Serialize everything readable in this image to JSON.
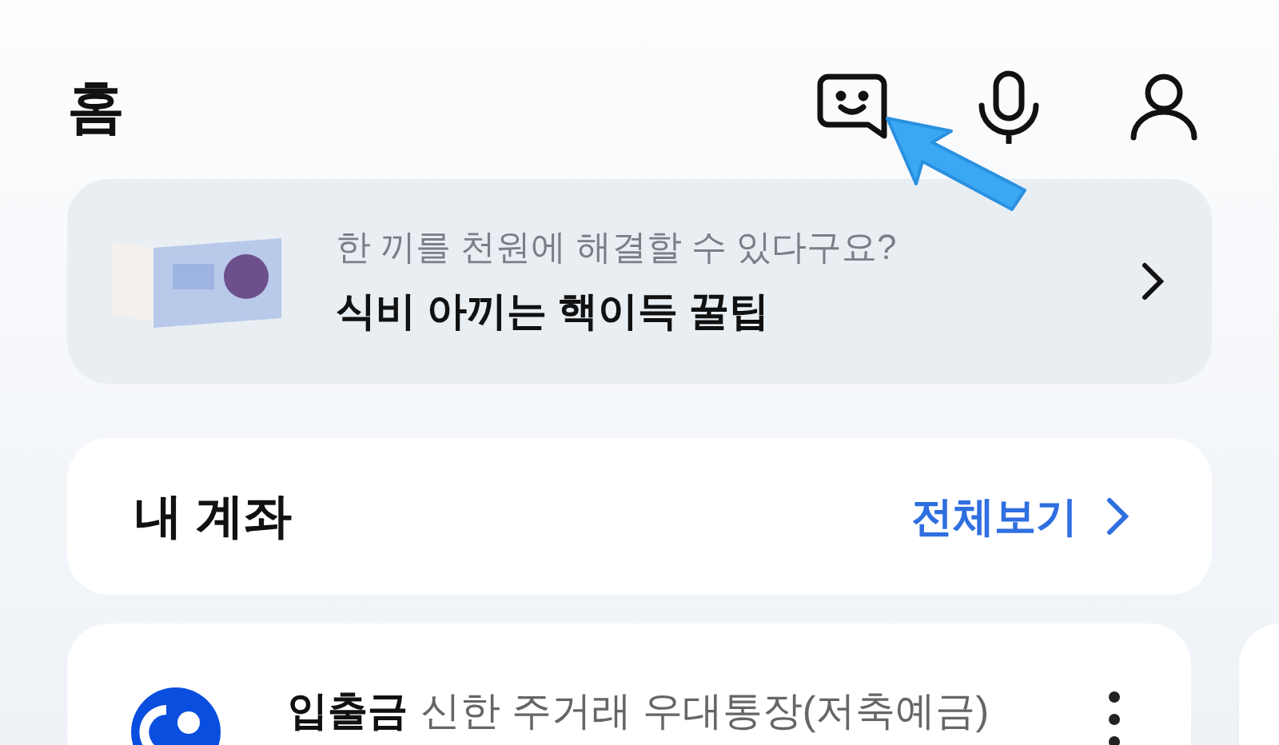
{
  "header": {
    "title": "홈"
  },
  "banner": {
    "subtitle": "한 끼를 천원에 해결할 수 있다구요?",
    "title": "식비 아끼는 핵이득 꿀팁"
  },
  "accounts_card": {
    "title": "내 계좌",
    "link": "전체보기"
  },
  "account": {
    "type": "입출금",
    "name": "신한 주거래 우대통장(저축예금)"
  }
}
